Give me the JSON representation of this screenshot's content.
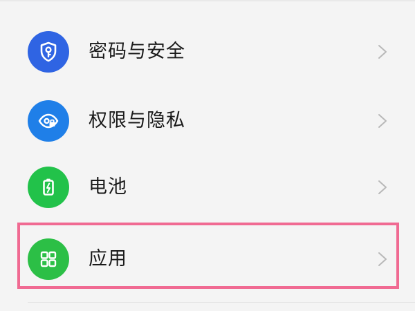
{
  "settings": {
    "items": [
      {
        "label": "密码与安全",
        "icon": "shield-key-icon",
        "icon_color": "#2f64e3"
      },
      {
        "label": "权限与隐私",
        "icon": "eye-lock-icon",
        "icon_color": "#1f7fe8"
      },
      {
        "label": "电池",
        "icon": "battery-icon",
        "icon_color": "#22c24a"
      },
      {
        "label": "应用",
        "icon": "grid-icon",
        "icon_color": "#2cbf46"
      }
    ]
  },
  "highlight": {
    "target": "应用",
    "color": "#f06a92"
  },
  "colors": {
    "background": "#f4f4f4",
    "text": "#1a1a1a",
    "chevron": "#b8b8b8"
  }
}
